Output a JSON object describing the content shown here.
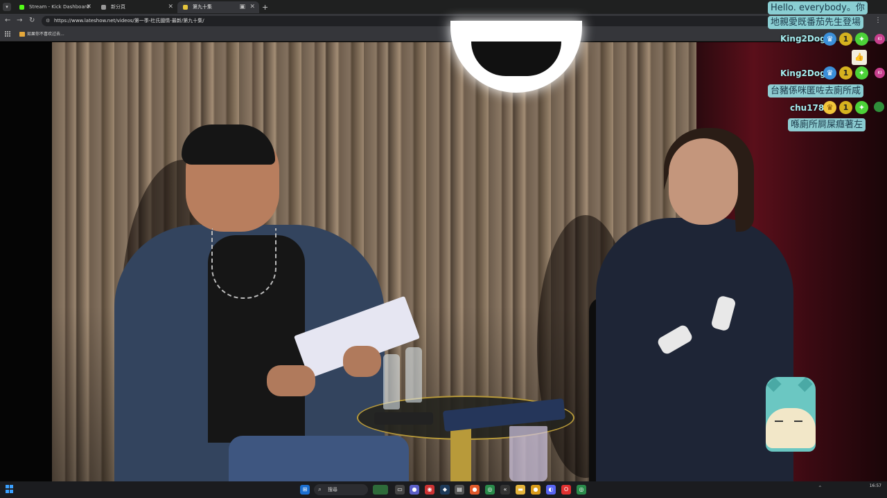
{
  "browser": {
    "tabs": [
      {
        "title": "Stream - Kick Dashboard",
        "active": false,
        "icon_color": "#53fc18"
      },
      {
        "title": "新分頁",
        "active": false,
        "icon_color": "#999999"
      },
      {
        "title": "第九十集",
        "active": true,
        "icon_color": "#e5c43b"
      }
    ],
    "new_tab_label": "+",
    "url": "https://www.lateshow.net/videos/第一季-杜氏國情-最新/第九十集/",
    "bookmark": "如果你不喜欢过去..."
  },
  "chat": {
    "messages": [
      {
        "text": "Hello. everybody。你"
      },
      {
        "text": "地親愛既番茄先生登場"
      },
      {
        "user": "King2Dog",
        "avatar": "KI"
      },
      {
        "emote": "thumbs"
      },
      {
        "user": "King2Dog",
        "avatar": "KI"
      },
      {
        "text": "台豬係咪匿咗去廁所咸"
      },
      {
        "user": "chu178"
      },
      {
        "text": "喺廁所屙屎癮著左"
      }
    ],
    "badges": {
      "rank_label": "1"
    }
  },
  "taskbar": {
    "search_label": "搜尋",
    "clock": "16:57"
  },
  "colors": {
    "chat_bubble": "#96e1e6",
    "chat_user": "#a6ecef",
    "kick_green": "#53fc18"
  }
}
